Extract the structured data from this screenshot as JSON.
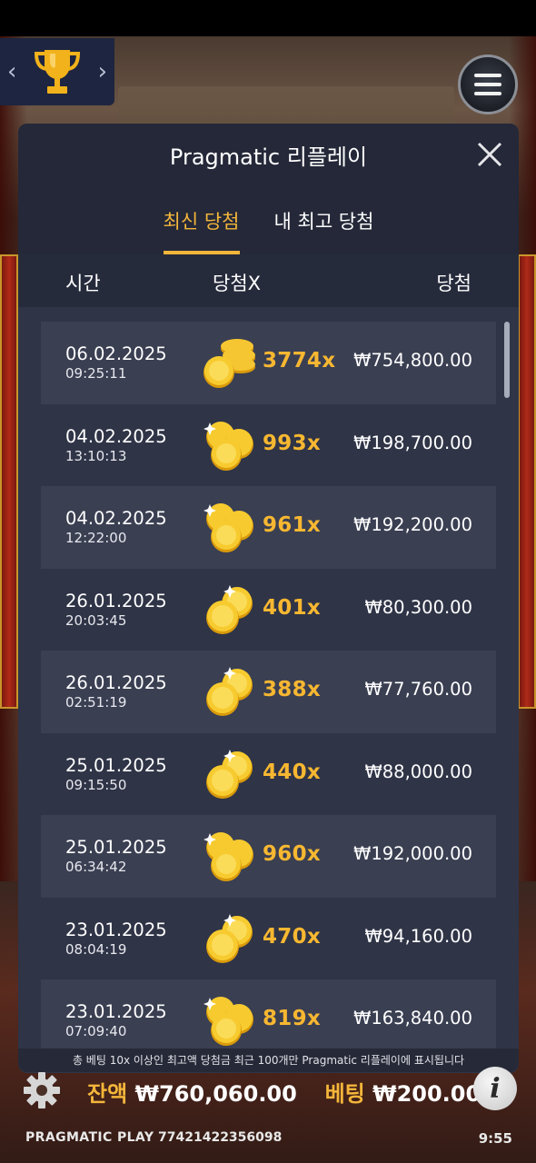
{
  "modal": {
    "title": "Pragmatic 리플레이",
    "tabs": [
      {
        "label": "최신 당첨",
        "active": true
      },
      {
        "label": "내 최고 당첨",
        "active": false
      }
    ],
    "columns": {
      "time": "시간",
      "multiplier": "당첨X",
      "win": "당첨"
    },
    "rows": [
      {
        "date": "06.02.2025",
        "time": "09:25:11",
        "multiplier": "3774x",
        "amount": "₩754,800.00",
        "coin_icon": "coin-stack-icon"
      },
      {
        "date": "04.02.2025",
        "time": "13:10:13",
        "multiplier": "993x",
        "amount": "₩198,700.00",
        "coin_icon": "three-coins-icon"
      },
      {
        "date": "04.02.2025",
        "time": "12:22:00",
        "multiplier": "961x",
        "amount": "₩192,200.00",
        "coin_icon": "three-coins-icon"
      },
      {
        "date": "26.01.2025",
        "time": "20:03:45",
        "multiplier": "401x",
        "amount": "₩80,300.00",
        "coin_icon": "two-coins-icon"
      },
      {
        "date": "26.01.2025",
        "time": "02:51:19",
        "multiplier": "388x",
        "amount": "₩77,760.00",
        "coin_icon": "two-coins-icon"
      },
      {
        "date": "25.01.2025",
        "time": "09:15:50",
        "multiplier": "440x",
        "amount": "₩88,000.00",
        "coin_icon": "two-coins-icon"
      },
      {
        "date": "25.01.2025",
        "time": "06:34:42",
        "multiplier": "960x",
        "amount": "₩192,000.00",
        "coin_icon": "three-coins-icon"
      },
      {
        "date": "23.01.2025",
        "time": "08:04:19",
        "multiplier": "470x",
        "amount": "₩94,160.00",
        "coin_icon": "two-coins-icon"
      },
      {
        "date": "23.01.2025",
        "time": "07:09:40",
        "multiplier": "819x",
        "amount": "₩163,840.00",
        "coin_icon": "three-coins-icon"
      }
    ],
    "footer_note": "총 베팅 10x 이상인 최고액 당첨금 최근 100개만 Pragmatic 리플레이에 표시됩니다"
  },
  "bottom_bar": {
    "balance_label": "잔액",
    "balance_value": "₩760,060.00",
    "bet_label": "베팅",
    "bet_value": "₩200.00",
    "brand": "PRAGMATIC PLAY",
    "round_id": "77421422356098",
    "clock": "9:55"
  },
  "colors": {
    "accent": "#f4b63a",
    "modal_bg": "#2f3447",
    "header_bg": "#242838"
  }
}
